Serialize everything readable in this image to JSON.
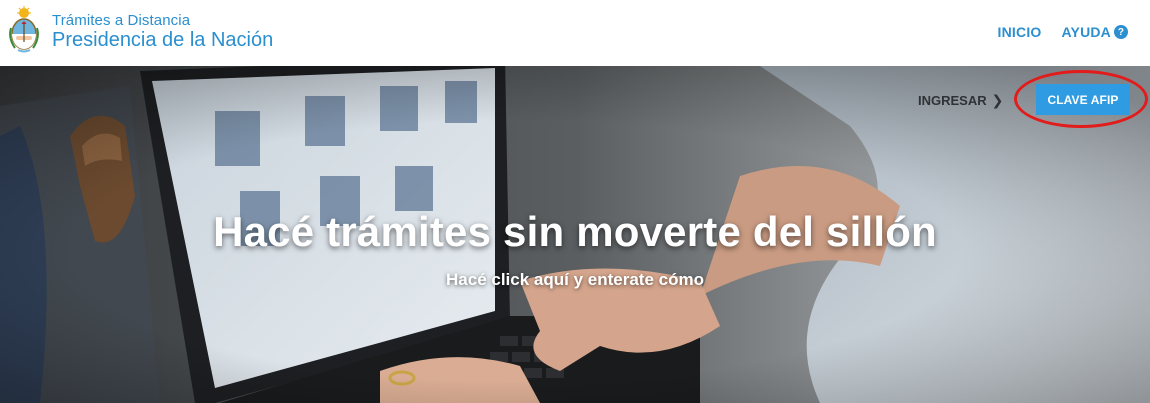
{
  "header": {
    "brand_line1": "Trámites a Distancia",
    "brand_line2": "Presidencia de la Nación",
    "nav": {
      "inicio": "INICIO",
      "ayuda": "AYUDA",
      "help_icon": "question-circle-icon"
    }
  },
  "hero": {
    "ingresar_label": "INGRESAR",
    "clave_afip_label": "CLAVE AFIP",
    "title": "Hacé trámites sin moverte del sillón",
    "subtitle": "Hacé click aquí y enterate cómo"
  },
  "colors": {
    "brand_blue": "#2a8fcf",
    "button_blue": "#2e9be3",
    "highlight_red": "#e21b1b"
  }
}
